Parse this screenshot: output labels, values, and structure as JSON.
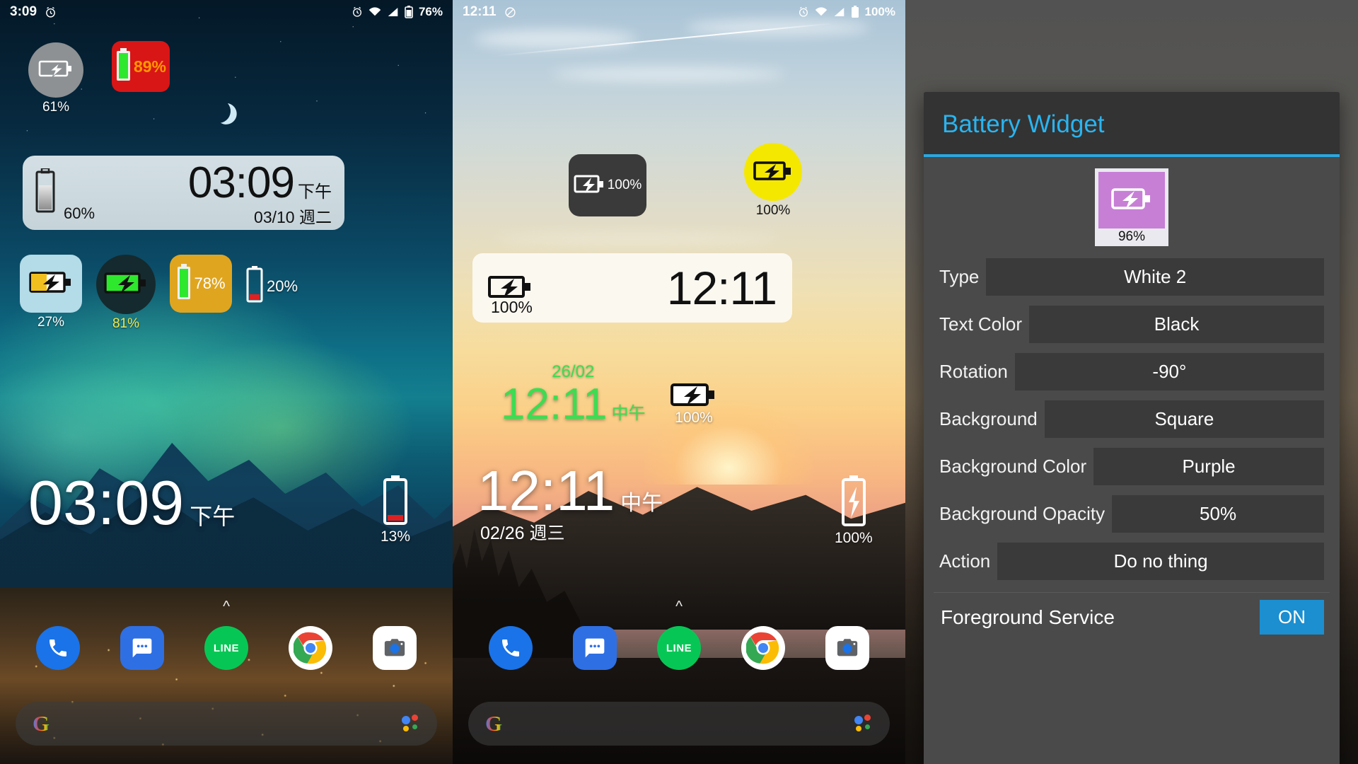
{
  "panel_left": {
    "statusbar": {
      "time": "3:09",
      "alarm_icon": "alarm-icon",
      "clock_icon": "alarm-icon",
      "wifi_icon": "wifi-icon",
      "signal_icon": "signal-icon",
      "battery_icon": "battery-icon",
      "battery_text": "76%"
    },
    "widgets": [
      {
        "name": "grey-circle-battery",
        "percent": "61%",
        "label_color": "#ffffff",
        "shape": "circle",
        "bg": "#8d9194",
        "icon": "battery-charging-white"
      },
      {
        "name": "red-square-battery",
        "percent": "89%",
        "inline": true,
        "shape": "rounded-square",
        "bg": "#d81616",
        "text_color": "#ff9800",
        "icon": "battery-vertical-green"
      }
    ],
    "clock_widget": {
      "time": "03:09",
      "ampm": "下午",
      "percent": "60%",
      "date": "03/10 週二",
      "bg": "#ccd9de",
      "text_color": "#111111"
    },
    "row_widgets": [
      {
        "name": "light-blue-square-battery",
        "percent": "27%",
        "bg": "#b4dbe8",
        "icon": "battery-charging-yellow",
        "label_color": "#ffffff"
      },
      {
        "name": "dark-circle-battery",
        "percent": "81%",
        "bg": "#152a2e",
        "icon": "battery-charging-green",
        "label_color": "#f2e94e"
      },
      {
        "name": "orange-square-battery",
        "percent": "78%",
        "bg": "#e0a51f",
        "icon": "battery-vertical-green",
        "inline": true,
        "text_color": "#ffffff"
      },
      {
        "name": "transparent-battery",
        "percent": "20%",
        "inline": true,
        "icon": "battery-vertical-low",
        "text_color": "#ffffff"
      }
    ],
    "big_clock": {
      "time": "03:09",
      "ampm": "下午"
    },
    "side_battery": {
      "percent": "13%",
      "icon": "battery-vertical-low",
      "text_color": "#ffffff"
    },
    "dock": [
      {
        "name": "phone-icon",
        "label": "Phone"
      },
      {
        "name": "messages-icon",
        "label": "Messages"
      },
      {
        "name": "line-icon",
        "label": "LINE"
      },
      {
        "name": "chrome-icon",
        "label": "Chrome"
      },
      {
        "name": "camera-icon",
        "label": "Camera"
      }
    ],
    "search": {
      "logo": "G",
      "assistant_icon": "google-assistant-icon"
    },
    "chevron": "^"
  },
  "panel_mid": {
    "statusbar": {
      "time": "12:11",
      "dnd_icon": "do-not-disturb-icon",
      "alarm_icon": "alarm-icon",
      "wifi_icon": "wifi-icon",
      "signal_icon": "signal-icon",
      "battery_icon": "battery-icon",
      "battery_text": "100%"
    },
    "widgets": [
      {
        "name": "dark-square-battery",
        "percent": "100%",
        "inline": true,
        "bg": "#3a3a3a",
        "text_color": "#ffffff",
        "icon": "battery-charging-white"
      },
      {
        "name": "yellow-circle-battery",
        "percent": "100%",
        "bg": "#f5e800",
        "icon": "battery-charging-black",
        "label_color": "#111111"
      }
    ],
    "clock_widget": {
      "time": "12:11",
      "percent": "100%",
      "bg": "#fbf8f0",
      "text_color": "#111111",
      "icon": "battery-charging-black"
    },
    "green_clock": {
      "date": "26/02",
      "time": "12:11",
      "ampm": "中午",
      "color": "#3ddc52"
    },
    "mid_battery": {
      "percent": "100%",
      "icon": "battery-charging-black",
      "text_color": "#ffffff"
    },
    "big_clock": {
      "time": "12:11",
      "ampm": "中午",
      "date": "02/26 週三"
    },
    "side_battery": {
      "percent": "100%",
      "icon": "battery-charging-white",
      "text_color": "#ffffff"
    },
    "dock": [
      {
        "name": "phone-icon",
        "label": "Phone"
      },
      {
        "name": "messages-icon",
        "label": "Messages"
      },
      {
        "name": "line-icon",
        "label": "LINE"
      },
      {
        "name": "chrome-icon",
        "label": "Chrome"
      },
      {
        "name": "camera-icon",
        "label": "Camera"
      }
    ],
    "search": {
      "logo": "G",
      "assistant_icon": "google-assistant-icon"
    },
    "chevron": "^"
  },
  "panel_right": {
    "dialog_title": "Battery Widget",
    "accent_color": "#2ab4ef",
    "preview": {
      "percent": "96%",
      "bg_color": "#c77fd6",
      "icon": "battery-charging-white"
    },
    "settings": [
      {
        "label": "Type",
        "value": "White 2"
      },
      {
        "label": "Text Color",
        "value": "Black"
      },
      {
        "label": "Rotation",
        "value": "-90°"
      },
      {
        "label": "Background",
        "value": "Square"
      },
      {
        "label": "Background Color",
        "value": "Purple"
      },
      {
        "label": "Background Opacity",
        "value": "50%"
      },
      {
        "label": "Action",
        "value": "Do no thing"
      }
    ],
    "foreground_service": {
      "label": "Foreground Service",
      "state": "ON",
      "on_color": "#1b8fd0"
    }
  }
}
